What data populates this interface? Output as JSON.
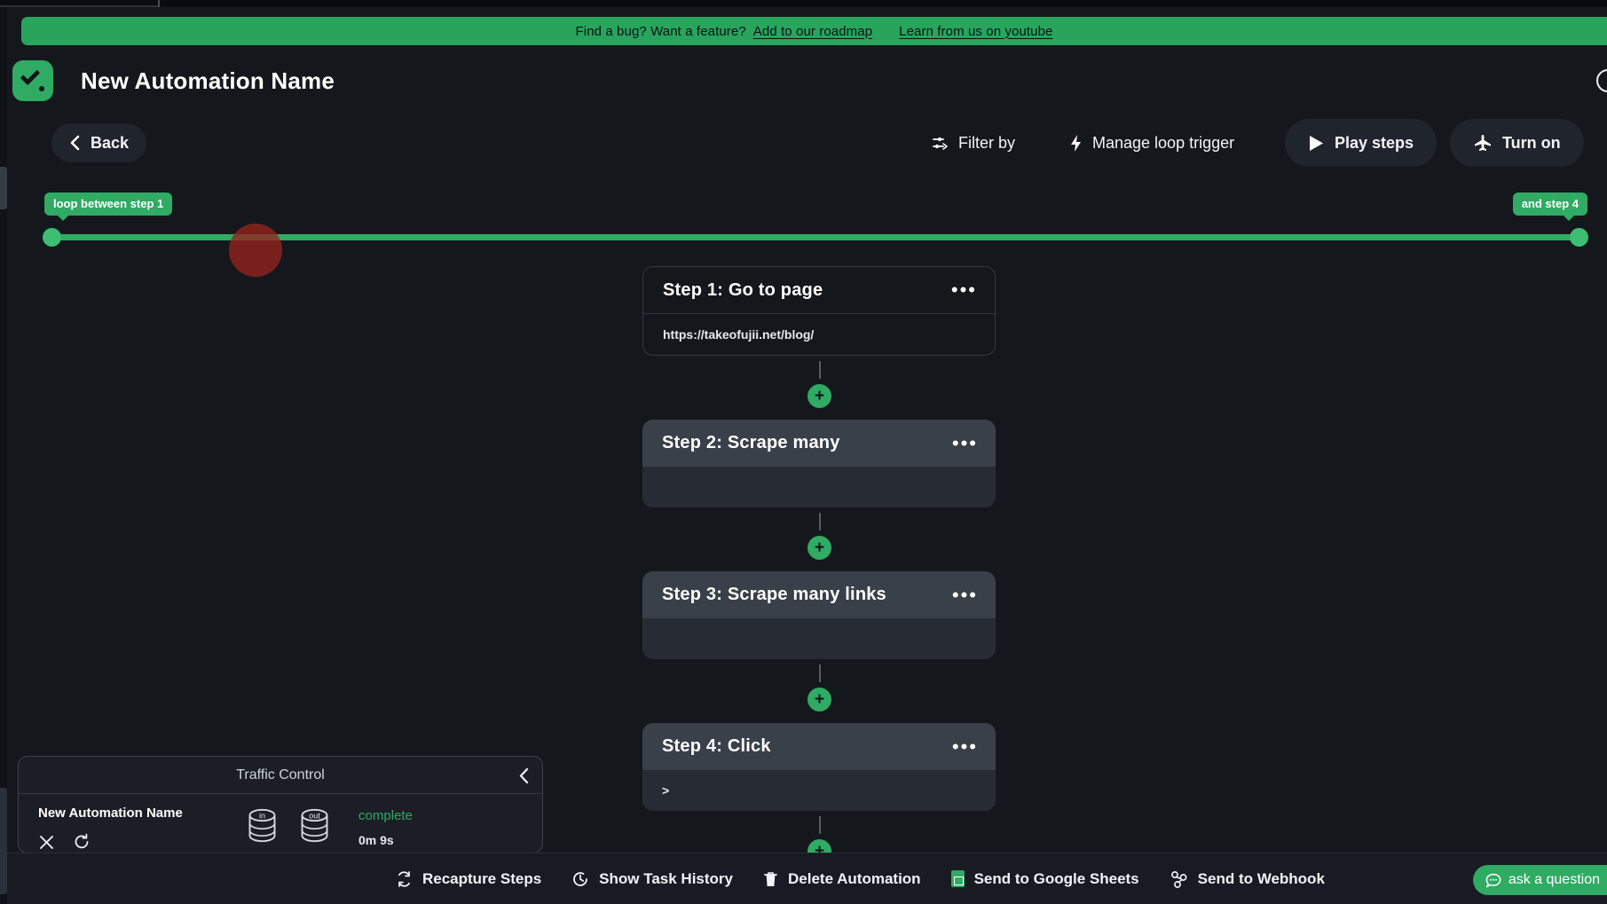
{
  "promo": {
    "text": "Find a bug? Want a feature?",
    "link_roadmap": "Add to our roadmap",
    "link_youtube": "Learn from us on youtube"
  },
  "header": {
    "title": "New Automation Name",
    "logo_icon": "checkmark-logo-icon",
    "help_icon": "help-circle-icon"
  },
  "toolbar": {
    "back": "Back",
    "back_icon": "chevron-left-icon",
    "filter": "Filter by",
    "filter_icon": "filter-sliders-icon",
    "loop_trigger": "Manage loop trigger",
    "loop_trigger_icon": "lightning-bolt-icon",
    "play": "Play steps",
    "play_icon": "play-triangle-icon",
    "turn_on": "Turn on",
    "turn_on_icon": "airplane-icon"
  },
  "loop_slider": {
    "left_label": "loop between step 1",
    "right_label": "and step 4",
    "track_color": "#2fab63"
  },
  "steps": [
    {
      "title": "Step 1: Go to page",
      "body": "https://takeofujii.net/blog/",
      "shaded": false,
      "menu_icon": "more-options-icon"
    },
    {
      "title": "Step 2: Scrape many",
      "body": "",
      "shaded": true,
      "menu_icon": "more-options-icon"
    },
    {
      "title": "Step 3: Scrape many links",
      "body": "",
      "shaded": true,
      "menu_icon": "more-options-icon"
    },
    {
      "title": "Step 4: Click",
      "body": ">",
      "shaded": true,
      "menu_icon": "more-options-icon"
    }
  ],
  "add_step_label": "+",
  "traffic_control": {
    "title": "Traffic Control",
    "collapse_icon": "chevron-left-icon",
    "row_name": "New Automation Name",
    "cancel_icon": "close-x-icon",
    "refresh_icon": "refresh-icon",
    "in_label": "in",
    "out_label": "out",
    "status": "complete",
    "status_color": "#2fab63",
    "elapsed": "0m 9s"
  },
  "bottom_bar": {
    "items": [
      {
        "label": "Recapture Steps",
        "icon": "recapture-icon"
      },
      {
        "label": "Show Task History",
        "icon": "clock-history-icon"
      },
      {
        "label": "Delete Automation",
        "icon": "trash-icon"
      },
      {
        "label": "Send to Google Sheets",
        "icon": "google-sheets-icon"
      },
      {
        "label": "Send to Webhook",
        "icon": "webhook-icon"
      }
    ],
    "ask": "ask a question",
    "ask_icon": "chat-bubble-icon"
  }
}
